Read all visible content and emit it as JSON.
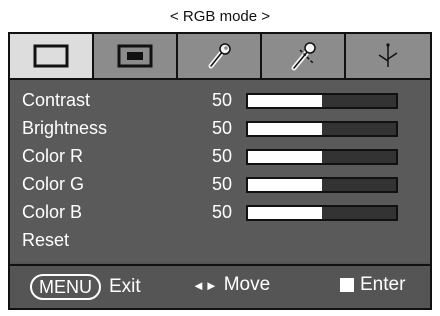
{
  "header": {
    "mode_title": "< RGB mode >"
  },
  "tabs": [
    {
      "name": "picture",
      "icon": "monitor-icon",
      "active": true
    },
    {
      "name": "screen",
      "icon": "screen-inset-icon",
      "active": false
    },
    {
      "name": "setup",
      "icon": "wrench-icon",
      "active": false
    },
    {
      "name": "tools",
      "icon": "tools-icon",
      "active": false
    },
    {
      "name": "special",
      "icon": "special-icon",
      "active": false
    }
  ],
  "menu": {
    "items": [
      {
        "label": "Contrast",
        "value": "50",
        "level": 0.5
      },
      {
        "label": "Brightness",
        "value": "50",
        "level": 0.5
      },
      {
        "label": "Color R",
        "value": "50",
        "level": 0.5
      },
      {
        "label": "Color G",
        "value": "50",
        "level": 0.5
      },
      {
        "label": "Color B",
        "value": "50",
        "level": 0.5
      },
      {
        "label": "Reset"
      }
    ]
  },
  "footer": {
    "menu_key": "MENU",
    "exit": "Exit",
    "arrows": "◄►",
    "move": "Move",
    "enter": "Enter"
  },
  "colors": {
    "panel": "#555555",
    "tab_bar": "#8c8c8c",
    "active_tab": "#dddddd",
    "bar_fill": "#ffffff"
  }
}
